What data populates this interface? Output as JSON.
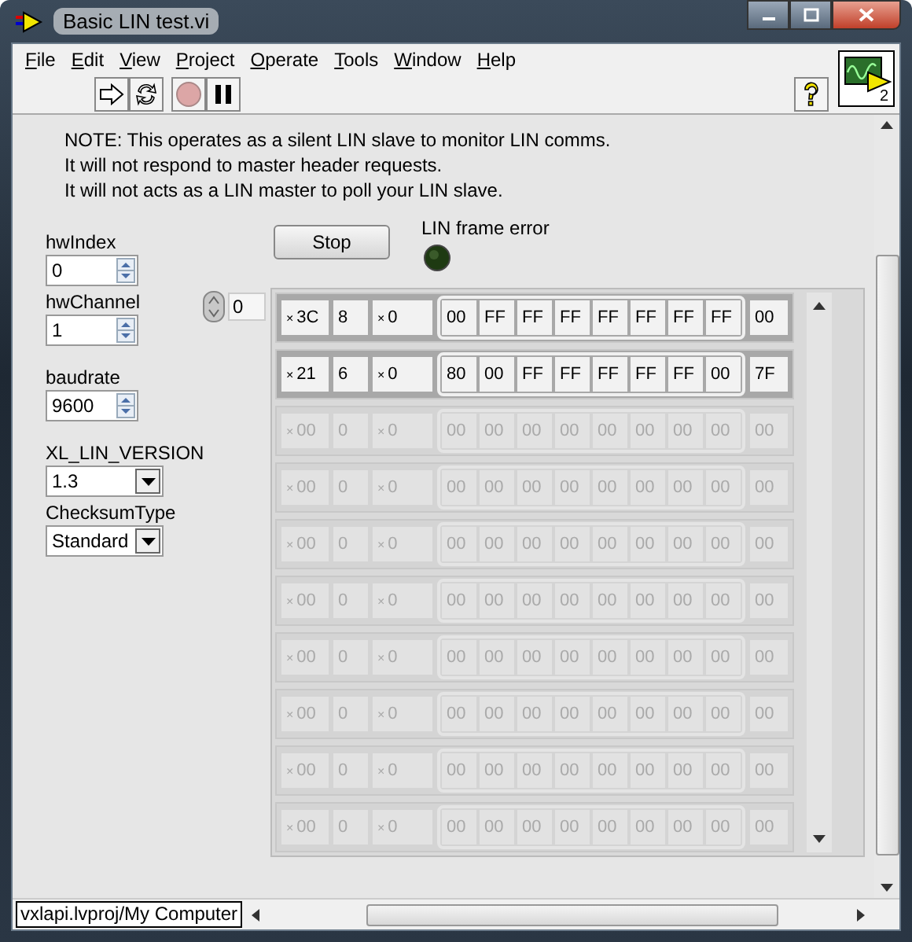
{
  "window": {
    "title": "Basic LIN test.vi"
  },
  "menu": [
    {
      "label": "File"
    },
    {
      "label": "Edit"
    },
    {
      "label": "View"
    },
    {
      "label": "Project"
    },
    {
      "label": "Operate"
    },
    {
      "label": "Tools"
    },
    {
      "label": "Window"
    },
    {
      "label": "Help"
    }
  ],
  "vi_icon": {
    "label": "2"
  },
  "note": [
    "NOTE: This operates as a silent LIN slave to monitor LIN comms.",
    "It will not respond to master header requests.",
    "It will not acts as a LIN master to poll your LIN slave."
  ],
  "controls": [
    {
      "kind": "numeric",
      "label": "hwIndex",
      "value": "0"
    },
    {
      "kind": "numeric",
      "label": "hwChannel",
      "value": "1"
    },
    {
      "kind": "numeric",
      "label": "baudrate",
      "value": "9600"
    },
    {
      "kind": "ring",
      "label": "XL_LIN_VERSION",
      "value": "1.3"
    },
    {
      "kind": "ring",
      "label": "ChecksumType",
      "value": "Standard"
    }
  ],
  "stop_button": {
    "label": "Stop"
  },
  "led": {
    "label": "LIN frame error",
    "on": false
  },
  "array_index": "0",
  "rows": [
    {
      "disabled": false,
      "id_radix": "×",
      "id": "3C",
      "dlc": "8",
      "flags_radix": "×",
      "flags": "0",
      "data": [
        "00",
        "FF",
        "FF",
        "FF",
        "FF",
        "FF",
        "FF",
        "FF"
      ],
      "checksum": "00"
    },
    {
      "disabled": false,
      "id_radix": "×",
      "id": "21",
      "dlc": "6",
      "flags_radix": "×",
      "flags": "0",
      "data": [
        "80",
        "00",
        "FF",
        "FF",
        "FF",
        "FF",
        "FF",
        "00"
      ],
      "checksum": "7F"
    },
    {
      "disabled": true,
      "id_radix": "×",
      "id": "00",
      "dlc": "0",
      "flags_radix": "×",
      "flags": "0",
      "data": [
        "00",
        "00",
        "00",
        "00",
        "00",
        "00",
        "00",
        "00"
      ],
      "checksum": "00"
    },
    {
      "disabled": true,
      "id_radix": "×",
      "id": "00",
      "dlc": "0",
      "flags_radix": "×",
      "flags": "0",
      "data": [
        "00",
        "00",
        "00",
        "00",
        "00",
        "00",
        "00",
        "00"
      ],
      "checksum": "00"
    },
    {
      "disabled": true,
      "id_radix": "×",
      "id": "00",
      "dlc": "0",
      "flags_radix": "×",
      "flags": "0",
      "data": [
        "00",
        "00",
        "00",
        "00",
        "00",
        "00",
        "00",
        "00"
      ],
      "checksum": "00"
    },
    {
      "disabled": true,
      "id_radix": "×",
      "id": "00",
      "dlc": "0",
      "flags_radix": "×",
      "flags": "0",
      "data": [
        "00",
        "00",
        "00",
        "00",
        "00",
        "00",
        "00",
        "00"
      ],
      "checksum": "00"
    },
    {
      "disabled": true,
      "id_radix": "×",
      "id": "00",
      "dlc": "0",
      "flags_radix": "×",
      "flags": "0",
      "data": [
        "00",
        "00",
        "00",
        "00",
        "00",
        "00",
        "00",
        "00"
      ],
      "checksum": "00"
    },
    {
      "disabled": true,
      "id_radix": "×",
      "id": "00",
      "dlc": "0",
      "flags_radix": "×",
      "flags": "0",
      "data": [
        "00",
        "00",
        "00",
        "00",
        "00",
        "00",
        "00",
        "00"
      ],
      "checksum": "00"
    },
    {
      "disabled": true,
      "id_radix": "×",
      "id": "00",
      "dlc": "0",
      "flags_radix": "×",
      "flags": "0",
      "data": [
        "00",
        "00",
        "00",
        "00",
        "00",
        "00",
        "00",
        "00"
      ],
      "checksum": "00"
    },
    {
      "disabled": true,
      "id_radix": "×",
      "id": "00",
      "dlc": "0",
      "flags_radix": "×",
      "flags": "0",
      "data": [
        "00",
        "00",
        "00",
        "00",
        "00",
        "00",
        "00",
        "00"
      ],
      "checksum": "00"
    }
  ],
  "status_bar": {
    "path": "vxlapi.lvproj/My Computer"
  }
}
